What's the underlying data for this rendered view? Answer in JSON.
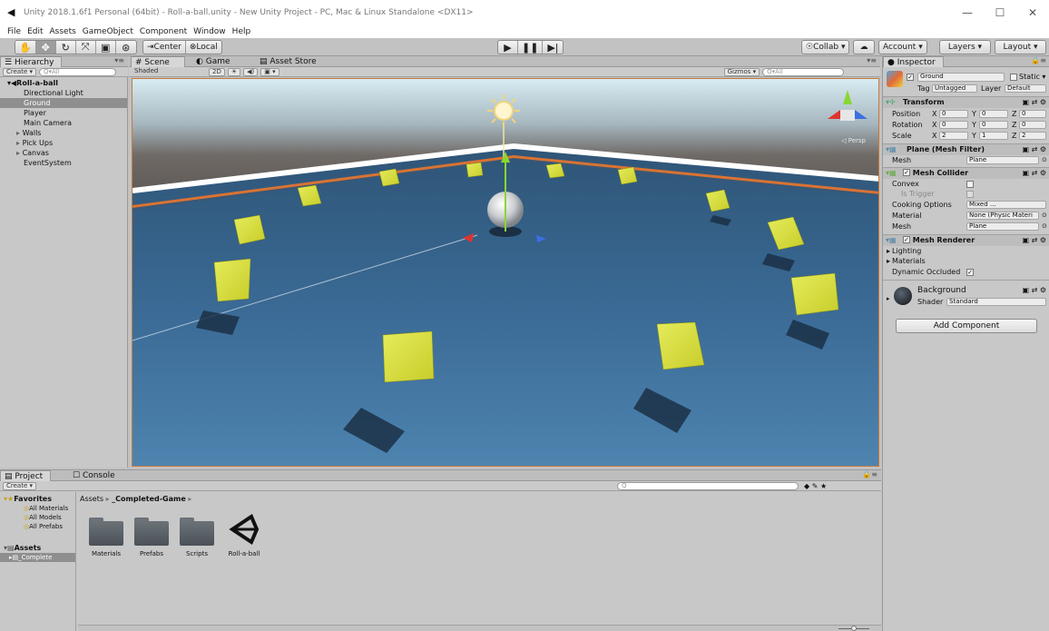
{
  "window": {
    "title": "Unity 2018.1.6f1 Personal (64bit) - Roll-a-ball.unity - New Unity Project - PC, Mac & Linux Standalone <DX11>",
    "minimize": "—",
    "maximize": "☐",
    "close": "✕"
  },
  "menu": [
    "File",
    "Edit",
    "Assets",
    "GameObject",
    "Component",
    "Window",
    "Help"
  ],
  "toolbar": {
    "pivot_center": "Center",
    "pivot_local": "Local",
    "collab": "Collab ▾",
    "account": "Account ▾",
    "layers": "Layers ▾",
    "layout": "Layout ▾"
  },
  "hierarchy": {
    "tab": "Hierarchy",
    "create": "Create ▾",
    "search_placeholder": "Q▾All",
    "scene_name": "Roll-a-ball",
    "items": [
      {
        "label": "Directional Light",
        "expander": ""
      },
      {
        "label": "Ground",
        "expander": ""
      },
      {
        "label": "Player",
        "expander": ""
      },
      {
        "label": "Main Camera",
        "expander": ""
      },
      {
        "label": "Walls",
        "expander": "▸"
      },
      {
        "label": "Pick Ups",
        "expander": "▸"
      },
      {
        "label": "Canvas",
        "expander": "▸"
      },
      {
        "label": "EventSystem",
        "expander": ""
      }
    ]
  },
  "scene": {
    "tabs": [
      "Scene",
      "Game",
      "Asset Store"
    ],
    "shading": "Shaded",
    "mode_2d": "2D",
    "gizmos": "Gizmos ▾",
    "search_placeholder": "Q▾All",
    "persp": "◁ Persp"
  },
  "inspector": {
    "tab": "Inspector",
    "object_name": "Ground",
    "static_label": "Static ▾",
    "tag_label": "Tag",
    "tag_value": "Untagged",
    "layer_label": "Layer",
    "layer_value": "Default",
    "transform": {
      "title": "Transform",
      "position": {
        "label": "Position",
        "x": "0",
        "y": "0",
        "z": "0"
      },
      "rotation": {
        "label": "Rotation",
        "x": "0",
        "y": "0",
        "z": "0"
      },
      "scale": {
        "label": "Scale",
        "x": "2",
        "y": "1",
        "z": "2"
      }
    },
    "mesh_filter": {
      "title": "Plane (Mesh Filter)",
      "mesh_label": "Mesh",
      "mesh_value": "Plane"
    },
    "mesh_collider": {
      "title": "Mesh Collider",
      "convex": "Convex",
      "is_trigger": "Is Trigger",
      "cooking_label": "Cooking Options",
      "cooking_value": "Mixed ...",
      "material_label": "Material",
      "material_value": "None (Physic Materi",
      "mesh_label": "Mesh",
      "mesh_value": "Plane"
    },
    "mesh_renderer": {
      "title": "Mesh Renderer",
      "lighting": "Lighting",
      "materials": "Materials",
      "dynamic_occluded": "Dynamic Occluded"
    },
    "material": {
      "name": "Background",
      "shader_label": "Shader",
      "shader_value": "Standard"
    },
    "add_component": "Add Component"
  },
  "project": {
    "tabs": [
      "Project",
      "Console"
    ],
    "create": "Create ▾",
    "favorites_label": "Favorites",
    "favorites": [
      "All Materials",
      "All Models",
      "All Prefabs"
    ],
    "assets_label": "Assets",
    "assets_child": "_Complete",
    "breadcrumb_root": "Assets",
    "breadcrumb_sep": "▸",
    "breadcrumb_folder": "_Completed-Game",
    "items": [
      "Materials",
      "Prefabs",
      "Scripts",
      "Roll-a-ball"
    ]
  }
}
